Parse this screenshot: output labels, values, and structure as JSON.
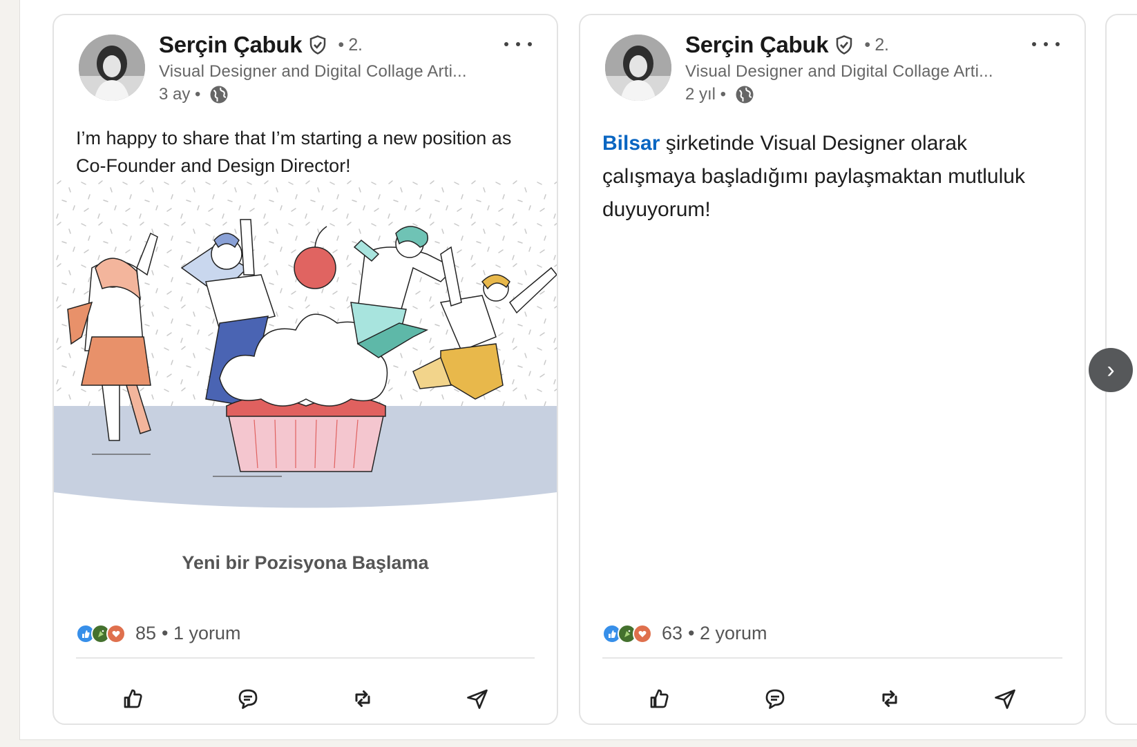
{
  "posts": [
    {
      "author": "Serçin Çabuk",
      "degree": "• 2.",
      "headline": "Visual Designer and Digital Collage Arti...",
      "time": "3 ay •",
      "text": "I’m happy to share that I’m starting a new position as Co-Founder and Design Director!",
      "caption": "Yeni bir Pozisyona Başlama",
      "reaction_count": "85",
      "comments": "• 1 yorum"
    },
    {
      "author": "Serçin Çabuk",
      "degree": "• 2.",
      "headline": "Visual Designer and Digital Collage Arti...",
      "time": "2 yıl •",
      "mention": "Bilsar",
      "text": " şirketinde Visual Designer olarak çalışmaya başladığımı paylaşmaktan mutluluk duyuyorum!",
      "reaction_count": "63",
      "comments": "• 2 yorum"
    }
  ],
  "icons": {
    "verified": "verified-badge-icon",
    "globe": "globe-icon",
    "more": "more-options-icon",
    "like": "like-icon",
    "comment": "comment-icon",
    "repost": "repost-icon",
    "send": "send-icon",
    "next": "chevron-right-icon"
  },
  "colors": {
    "link": "#0a66c2",
    "like_reaction": "#378fe9",
    "celebrate_reaction": "#44712e",
    "love_reaction": "#df704d"
  },
  "next_button": "›"
}
